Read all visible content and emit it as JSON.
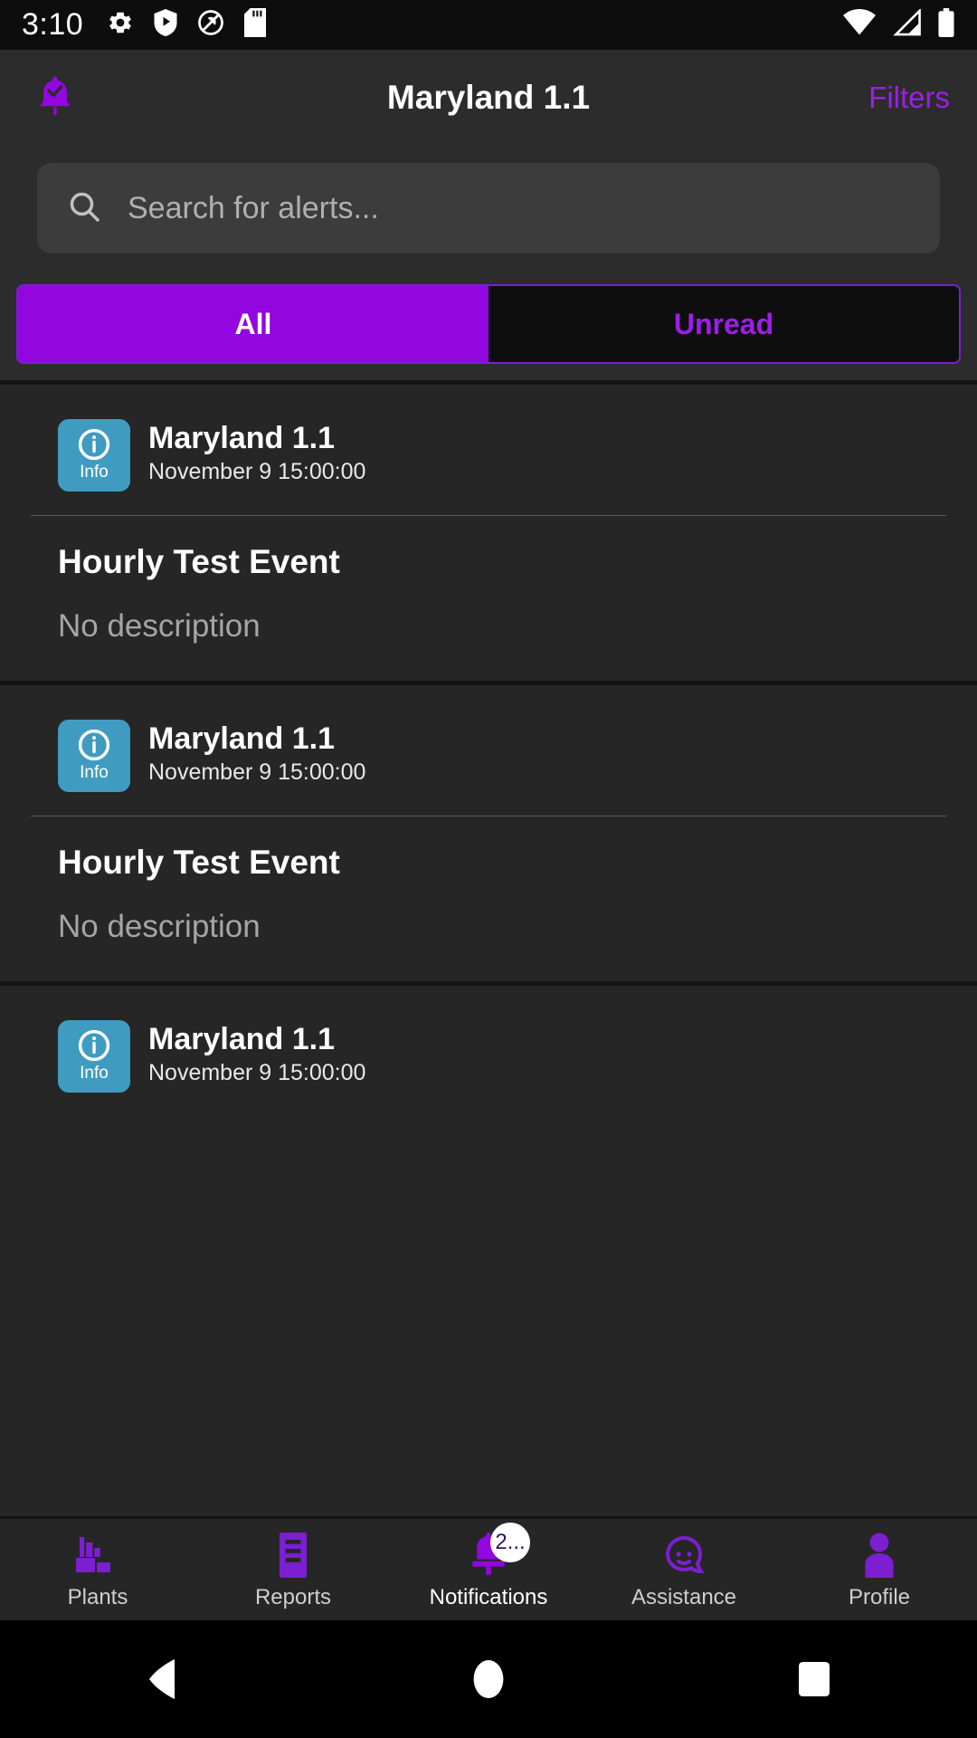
{
  "status_bar": {
    "time": "3:10",
    "left_icons": [
      "gear-icon",
      "shield-play-icon",
      "no-entry-icon",
      "sd-card-icon"
    ],
    "right_icons": [
      "wifi-icon",
      "cellular-signal-icon",
      "battery-icon"
    ]
  },
  "header": {
    "bell_icon": "bell-check-icon",
    "title": "Maryland 1.1",
    "filters_label": "Filters"
  },
  "search": {
    "icon": "search-icon",
    "placeholder": "Search for alerts..."
  },
  "tabs": {
    "all_label": "All",
    "unread_label": "Unread",
    "active": "All"
  },
  "alerts": [
    {
      "badge_label": "Info",
      "badge_icon": "info-circle-icon",
      "plant": "Maryland 1.1",
      "date": "November 9 15:00:00",
      "title": "Hourly Test Event",
      "description": "No description"
    },
    {
      "badge_label": "Info",
      "badge_icon": "info-circle-icon",
      "plant": "Maryland 1.1",
      "date": "November 9 15:00:00",
      "title": "Hourly Test Event",
      "description": "No description"
    },
    {
      "badge_label": "Info",
      "badge_icon": "info-circle-icon",
      "plant": "Maryland 1.1",
      "date": "November 9 15:00:00",
      "title": "",
      "description": ""
    }
  ],
  "bottom_nav": {
    "items": [
      {
        "label": "Plants",
        "icon": "factory-icon",
        "active": false,
        "badge": ""
      },
      {
        "label": "Reports",
        "icon": "document-icon",
        "active": false,
        "badge": ""
      },
      {
        "label": "Notifications",
        "icon": "bell-icon",
        "active": true,
        "badge": "2..."
      },
      {
        "label": "Assistance",
        "icon": "face-help-icon",
        "active": false,
        "badge": ""
      },
      {
        "label": "Profile",
        "icon": "person-icon",
        "active": false,
        "badge": ""
      }
    ]
  },
  "android_nav": {
    "back": "back-triangle-icon",
    "home": "home-circle-icon",
    "recents": "recents-square-icon"
  },
  "colors": {
    "accent_purple": "#9206E0",
    "link_purple": "#9C1FE8",
    "info_blue": "#3F9CC0",
    "surface": "#262626",
    "header_surface": "#2c2c2c"
  }
}
